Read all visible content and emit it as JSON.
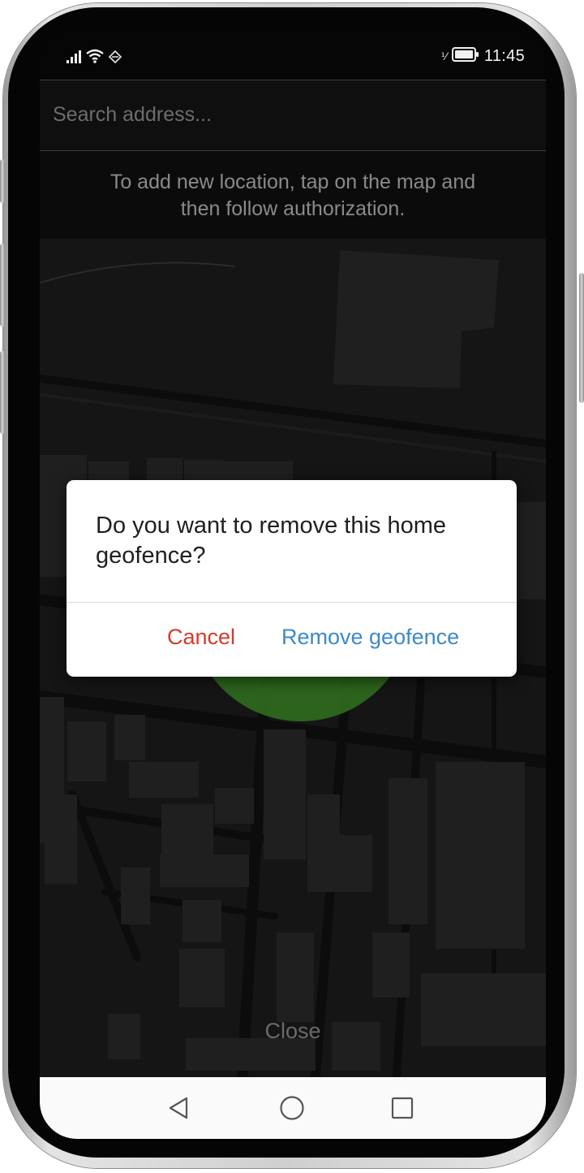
{
  "status_bar": {
    "time": "11:45",
    "icons": [
      "signal-icon",
      "wifi-icon",
      "data-saver-icon",
      "vibrate-icon",
      "battery-icon"
    ],
    "vibrate_glyph": "⅟"
  },
  "search": {
    "placeholder": "Search address...",
    "value": ""
  },
  "hint": {
    "text": "To add new location, tap on the map and then follow authorization."
  },
  "dialog": {
    "message": "Do you want to remove this home geofence?",
    "cancel_label": "Cancel",
    "confirm_label": "Remove geofence"
  },
  "close_label": "Close",
  "nav": {
    "icons": [
      "back-icon",
      "home-icon",
      "recents-icon"
    ]
  },
  "colors": {
    "cancel": "#d43b2c",
    "confirm": "#3d8ac7",
    "geofence": "#2f6b1e",
    "map_background": "#151515"
  }
}
